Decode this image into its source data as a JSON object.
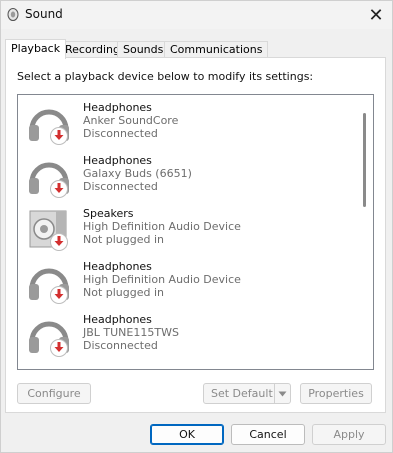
{
  "window": {
    "title": "Sound",
    "close_symbol": "✕",
    "title_icon": "speaker-icon"
  },
  "tabs": [
    {
      "label": "Playback",
      "active": true
    },
    {
      "label": "Recording",
      "active": false
    },
    {
      "label": "Sounds",
      "active": false
    },
    {
      "label": "Communications",
      "active": false
    }
  ],
  "playback": {
    "instructions": "Select a playback device below to modify its settings:",
    "devices": [
      {
        "name": "Headphones",
        "description": "Anker SoundCore",
        "status": "Disconnected",
        "icon": "headphones-icon",
        "badge": "red-down-arrow-icon"
      },
      {
        "name": "Headphones",
        "description": "Galaxy Buds (6651)",
        "status": "Disconnected",
        "icon": "headphones-icon",
        "badge": "red-down-arrow-icon"
      },
      {
        "name": "Speakers",
        "description": "High Definition Audio Device",
        "status": "Not plugged in",
        "icon": "speaker-icon",
        "badge": "red-down-arrow-icon"
      },
      {
        "name": "Headphones",
        "description": "High Definition Audio Device",
        "status": "Not plugged in",
        "icon": "headphones-icon",
        "badge": "red-down-arrow-icon"
      },
      {
        "name": "Headphones",
        "description": "JBL TUNE115TWS",
        "status": "Disconnected",
        "icon": "headphones-icon",
        "badge": "red-down-arrow-icon"
      },
      {
        "name": "",
        "description": "",
        "status": "",
        "icon": "headphones-icon",
        "badge": ""
      }
    ],
    "configure_label": "Configure",
    "set_default_label": "Set Default",
    "properties_label": "Properties"
  },
  "dialog_buttons": {
    "ok_label": "OK",
    "cancel_label": "Cancel",
    "apply_label": "Apply"
  },
  "colors": {
    "accent": "#0067c0",
    "badge_red": "#d32f2f",
    "disabled_text": "#8a8a8a"
  }
}
